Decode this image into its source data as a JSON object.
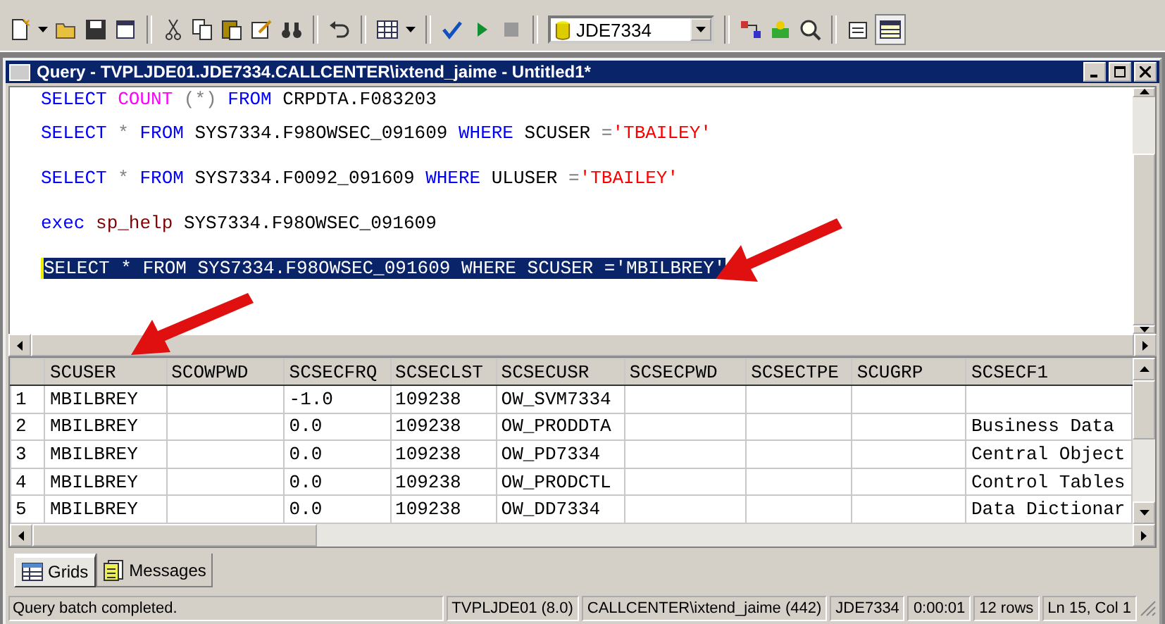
{
  "toolbar": {
    "database": "JDE7334"
  },
  "window": {
    "title": "Query - TVPLJDE01.JDE7334.CALLCENTER\\ixtend_jaime - Untitled1*"
  },
  "editor": {
    "lines": [
      {
        "selected": false,
        "tokens": [
          {
            "text": "SELECT",
            "kind": "keyword"
          },
          {
            "text": " COUNT",
            "kind": "function"
          },
          {
            "text": " (*)",
            "kind": "operator"
          },
          {
            "text": " FROM",
            "kind": "keyword"
          },
          {
            "text": " CRPDTA.F083203",
            "kind": "plain"
          }
        ]
      },
      {
        "selected": false,
        "tokens": [
          {
            "text": "SELECT",
            "kind": "keyword"
          },
          {
            "text": " *",
            "kind": "operator"
          },
          {
            "text": " FROM",
            "kind": "keyword"
          },
          {
            "text": " SYS7334.F98OWSEC_091609",
            "kind": "plain"
          },
          {
            "text": " WHERE",
            "kind": "keyword"
          },
          {
            "text": " SCUSER ",
            "kind": "plain"
          },
          {
            "text": "=",
            "kind": "operator"
          },
          {
            "text": "'TBAILEY'",
            "kind": "string"
          }
        ]
      },
      {
        "selected": false,
        "tokens": [
          {
            "text": "SELECT",
            "kind": "keyword"
          },
          {
            "text": " *",
            "kind": "operator"
          },
          {
            "text": " FROM",
            "kind": "keyword"
          },
          {
            "text": " SYS7334.F0092_091609",
            "kind": "plain"
          },
          {
            "text": " WHERE",
            "kind": "keyword"
          },
          {
            "text": " ULUSER ",
            "kind": "plain"
          },
          {
            "text": "=",
            "kind": "operator"
          },
          {
            "text": "'TBAILEY'",
            "kind": "string"
          }
        ]
      },
      {
        "selected": false,
        "tokens": [
          {
            "text": "exec",
            "kind": "keyword"
          },
          {
            "text": " sp_help",
            "kind": "procedure"
          },
          {
            "text": " SYS7334.F98OWSEC_091609",
            "kind": "plain"
          }
        ]
      },
      {
        "selected": true,
        "tokens": [
          {
            "text": "SELECT",
            "kind": "keyword"
          },
          {
            "text": " *",
            "kind": "operator"
          },
          {
            "text": " FROM",
            "kind": "keyword"
          },
          {
            "text": " SYS7334.F98OWSEC_091609",
            "kind": "plain"
          },
          {
            "text": " WHERE",
            "kind": "keyword"
          },
          {
            "text": " SCUSER ",
            "kind": "plain"
          },
          {
            "text": "=",
            "kind": "operator"
          },
          {
            "text": "'MBILBREY'",
            "kind": "string"
          }
        ]
      }
    ]
  },
  "results": {
    "columns": [
      "SCUSER",
      "SCOWPWD",
      "SCSECFRQ",
      "SCSECLST",
      "SCSECUSR",
      "SCSECPWD",
      "SCSECTPE",
      "SCUGRP",
      "SCSECF1"
    ],
    "rows": [
      {
        "number": "1",
        "cells": [
          "MBILBREY",
          null,
          "-1.0",
          "109238",
          "OW_SVM7334",
          null,
          null,
          null,
          null
        ]
      },
      {
        "number": "2",
        "cells": [
          "MBILBREY",
          null,
          "0.0",
          "109238",
          "OW_PRODDTA",
          null,
          null,
          null,
          "Business Data"
        ]
      },
      {
        "number": "3",
        "cells": [
          "MBILBREY",
          null,
          "0.0",
          "109238",
          "OW_PD7334",
          null,
          null,
          null,
          "Central Object"
        ]
      },
      {
        "number": "4",
        "cells": [
          "MBILBREY",
          null,
          "0.0",
          "109238",
          "OW_PRODCTL",
          null,
          null,
          null,
          "Control Tables"
        ]
      },
      {
        "number": "5",
        "cells": [
          "MBILBREY",
          null,
          "0.0",
          "109238",
          "OW_DD7334",
          null,
          null,
          null,
          "Data Dictionar"
        ]
      }
    ]
  },
  "tabs": [
    {
      "label": "Grids",
      "selected": true
    },
    {
      "label": "Messages",
      "selected": false
    }
  ],
  "status_bar": {
    "message": "Query batch completed.",
    "fields": [
      "TVPLJDE01 (8.0)",
      "CALLCENTER\\ixtend_jaime (442)",
      "JDE7334",
      "0:00:01",
      "12 rows",
      "Ln 15, Col 1"
    ]
  }
}
